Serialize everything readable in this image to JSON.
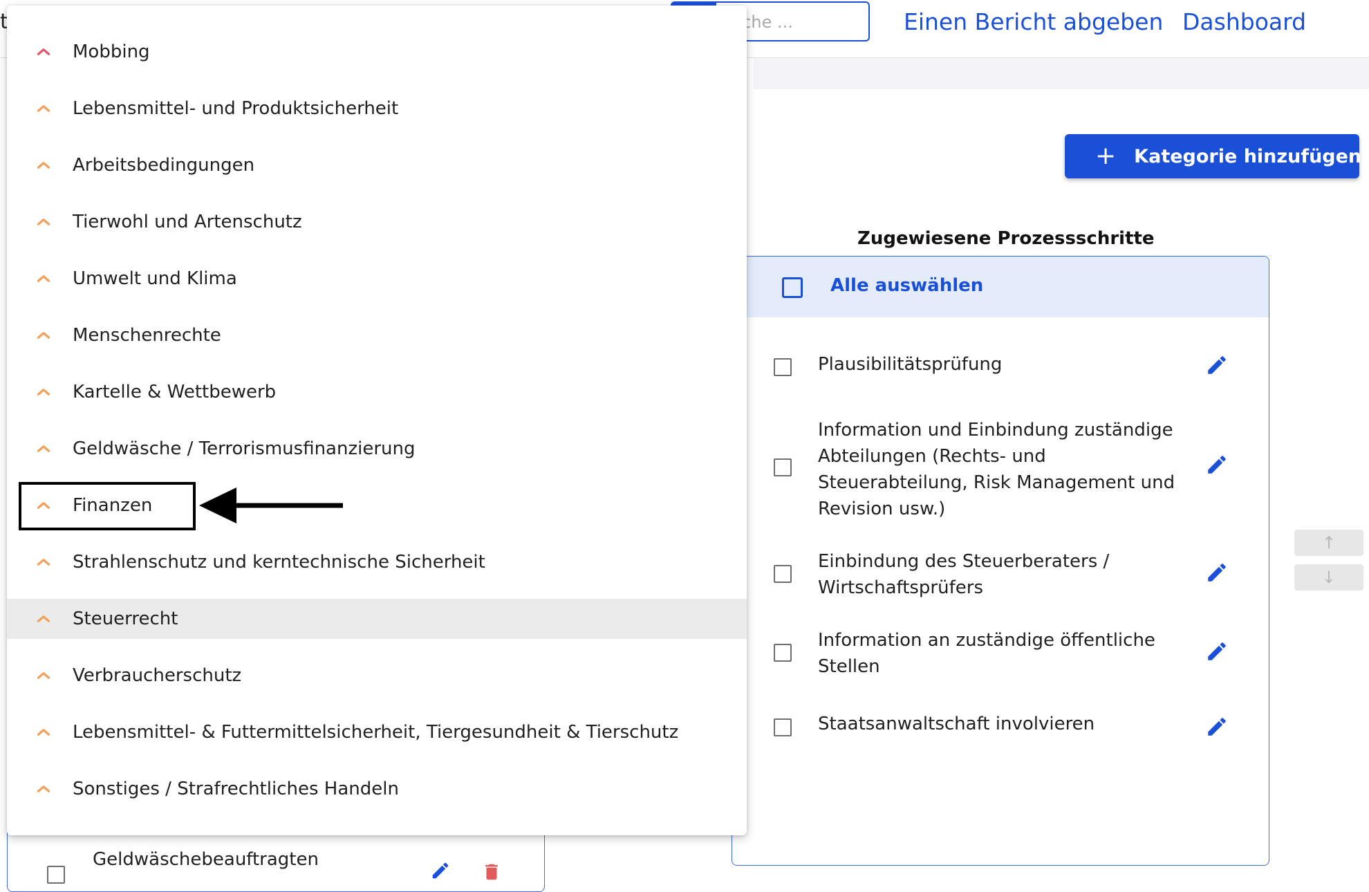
{
  "header": {
    "cut_text": "t",
    "search_placeholder": "uche ...",
    "nav": [
      {
        "label": "Einen Bericht abgeben"
      },
      {
        "label": "Dashboard"
      }
    ]
  },
  "toolbar": {
    "add_category_label": "Kategorie hinzufügen",
    "add_icon": "plus-icon"
  },
  "process_panel": {
    "title": "Zugewiesene Prozessschritte",
    "select_all_label": "Alle auswählen",
    "steps": [
      {
        "label": "Plausibilitätsprüfung"
      },
      {
        "label": "Information und Einbindung zuständige Abteilungen (Rechts- und Steuerabteilung, Risk Management und Revision usw.)"
      },
      {
        "label": "Einbindung des Steuerberaters / Wirtschaftsprüfers"
      },
      {
        "label": "Information an zuständige öffentliche Stellen"
      },
      {
        "label": "Staatsanwaltschaft involvieren"
      }
    ],
    "move_up": "↑",
    "move_down": "↓"
  },
  "background_list": {
    "visible_row_label": "Geldwäschebeauftragten"
  },
  "dropdown": {
    "items": [
      {
        "label": "Mobbing",
        "caret_color": "#e5556a"
      },
      {
        "label": "Lebensmittel- und Produktsicherheit",
        "caret_color": "#f0a15a"
      },
      {
        "label": "Arbeitsbedingungen",
        "caret_color": "#f0a15a"
      },
      {
        "label": "Tierwohl und Artenschutz",
        "caret_color": "#f0a15a"
      },
      {
        "label": "Umwelt und Klima",
        "caret_color": "#f0a15a"
      },
      {
        "label": "Menschenrechte",
        "caret_color": "#f0a15a"
      },
      {
        "label": "Kartelle & Wettbewerb",
        "caret_color": "#f0a15a"
      },
      {
        "label": "Geldwäsche / Terrorismusfinanzierung",
        "caret_color": "#f0a15a"
      },
      {
        "label": "Finanzen",
        "caret_color": "#f0a15a"
      },
      {
        "label": "Strahlenschutz und kerntechnische Sicherheit",
        "caret_color": "#f0a15a"
      },
      {
        "label": "Steuerrecht",
        "caret_color": "#f0a15a"
      },
      {
        "label": "Verbraucherschutz",
        "caret_color": "#f0a15a"
      },
      {
        "label": "Lebensmittel- & Futtermittelsicherheit, Tiergesundheit & Tierschutz",
        "caret_color": "#f0a15a"
      },
      {
        "label": "Sonstiges / Strafrechtliches Handeln",
        "caret_color": "#f0a15a"
      }
    ],
    "highlighted_label": "Steuerrecht",
    "annotated_label": "Finanzen"
  },
  "colors": {
    "accent": "#1a4fd8",
    "panel_head": "#e4ecfb",
    "highlight_row": "#ebebeb"
  }
}
